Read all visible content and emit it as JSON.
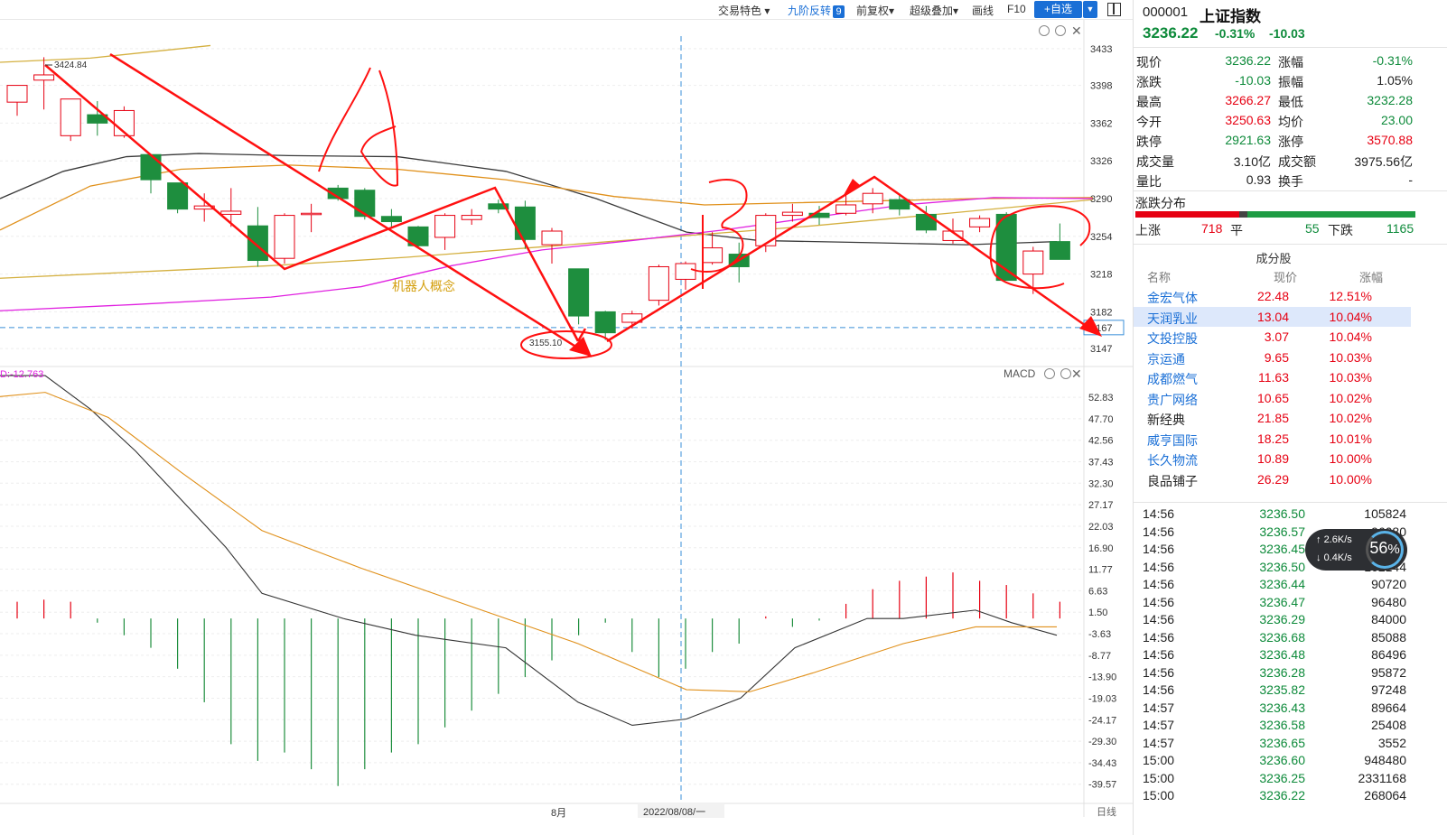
{
  "toolbar": {
    "items": [
      "交易特色",
      "九阶反转",
      "前复权",
      "超级叠加",
      "画线",
      "F10"
    ],
    "badge": "9",
    "add_button": "+自选"
  },
  "chart_data": [
    {
      "type": "candlestick",
      "title": "",
      "ylim": [
        3135,
        3445
      ],
      "y_ticks": [
        3433,
        3398,
        3362,
        3326,
        3290,
        3254,
        3218,
        3182,
        3147
      ],
      "candles": [
        {
          "o": 3382,
          "c": 3398,
          "h": 3398,
          "l": 3369
        },
        {
          "o": 3403,
          "c": 3408,
          "h": 3424.84,
          "l": 3375
        },
        {
          "o": 3350,
          "c": 3385,
          "h": 3385,
          "l": 3345
        },
        {
          "o": 3370,
          "c": 3362,
          "h": 3383,
          "l": 3350
        },
        {
          "o": 3350,
          "c": 3374,
          "h": 3378,
          "l": 3348
        },
        {
          "o": 3332,
          "c": 3308,
          "h": 3332,
          "l": 3295
        },
        {
          "o": 3305,
          "c": 3280,
          "h": 3305,
          "l": 3276
        },
        {
          "o": 3280,
          "c": 3283,
          "h": 3295,
          "l": 3268
        },
        {
          "o": 3275,
          "c": 3278,
          "h": 3300,
          "l": 3263
        },
        {
          "o": 3264,
          "c": 3231,
          "h": 3282,
          "l": 3225
        },
        {
          "o": 3233,
          "c": 3274,
          "h": 3276,
          "l": 3228
        },
        {
          "o": 3276,
          "c": 3276,
          "h": 3285,
          "l": 3258
        },
        {
          "o": 3300,
          "c": 3290,
          "h": 3303,
          "l": 3288
        },
        {
          "o": 3298,
          "c": 3273,
          "h": 3300,
          "l": 3270
        },
        {
          "o": 3273,
          "c": 3268,
          "h": 3280,
          "l": 3262
        },
        {
          "o": 3263,
          "c": 3245,
          "h": 3264,
          "l": 3243
        },
        {
          "o": 3253,
          "c": 3274,
          "h": 3276,
          "l": 3241
        },
        {
          "o": 3270,
          "c": 3274,
          "h": 3280,
          "l": 3265
        },
        {
          "o": 3285,
          "c": 3280,
          "h": 3289,
          "l": 3276
        },
        {
          "o": 3282,
          "c": 3251,
          "h": 3288,
          "l": 3242
        },
        {
          "o": 3246,
          "c": 3259,
          "h": 3262,
          "l": 3228
        },
        {
          "o": 3223,
          "c": 3178,
          "h": 3223,
          "l": 3170
        },
        {
          "o": 3182,
          "c": 3162,
          "h": 3183,
          "l": 3155.1
        },
        {
          "o": 3172,
          "c": 3180,
          "h": 3183,
          "l": 3166
        },
        {
          "o": 3193,
          "c": 3225,
          "h": 3227,
          "l": 3188
        },
        {
          "o": 3213,
          "c": 3228,
          "h": 3230,
          "l": 3203
        },
        {
          "o": 3229,
          "c": 3243,
          "h": 3258,
          "l": 3227
        },
        {
          "o": 3237,
          "c": 3225,
          "h": 3248,
          "l": 3210
        },
        {
          "o": 3245,
          "c": 3274,
          "h": 3276,
          "l": 3239
        },
        {
          "o": 3274,
          "c": 3277,
          "h": 3285,
          "l": 3268
        },
        {
          "o": 3276,
          "c": 3272,
          "h": 3283,
          "l": 3265
        },
        {
          "o": 3276,
          "c": 3284,
          "h": 3296,
          "l": 3274
        },
        {
          "o": 3285,
          "c": 3295,
          "h": 3300,
          "l": 3276
        },
        {
          "o": 3289,
          "c": 3280,
          "h": 3293,
          "l": 3274
        },
        {
          "o": 3275,
          "c": 3260,
          "h": 3283,
          "l": 3257
        },
        {
          "o": 3250,
          "c": 3259,
          "h": 3271,
          "l": 3247
        },
        {
          "o": 3263,
          "c": 3271,
          "h": 3274,
          "l": 3258
        },
        {
          "o": 3275,
          "c": 3212,
          "h": 3277,
          "l": 3212
        },
        {
          "o": 3218,
          "c": 3240,
          "h": 3244,
          "l": 3199
        },
        {
          "o": 3249,
          "c": 3232,
          "h": 3266.27,
          "l": 3232.28
        }
      ],
      "ma_lines": [
        {
          "color": "#3a3a3a",
          "points": [
            [
              0,
              3290
            ],
            [
              70,
              3316
            ],
            [
              140,
              3330
            ],
            [
              220,
              3333
            ],
            [
              320,
              3331
            ],
            [
              440,
              3330
            ],
            [
              560,
              3316
            ],
            [
              660,
              3290
            ],
            [
              760,
              3258
            ],
            [
              840,
              3250
            ],
            [
              960,
              3248
            ],
            [
              1070,
              3246
            ],
            [
              1170,
              3249
            ]
          ]
        },
        {
          "color": "#e0901a",
          "points": [
            [
              0,
              3260
            ],
            [
              100,
              3302
            ],
            [
              200,
              3318
            ],
            [
              320,
              3322
            ],
            [
              440,
              3318
            ],
            [
              560,
              3308
            ],
            [
              680,
              3292
            ],
            [
              780,
              3284
            ],
            [
              880,
              3286
            ],
            [
              980,
              3288
            ],
            [
              1080,
              3290
            ],
            [
              1210,
              3291
            ]
          ]
        },
        {
          "color": "#d4b040",
          "points": [
            [
              0,
              3214
            ],
            [
              150,
              3220
            ],
            [
              300,
              3226
            ],
            [
              450,
              3234
            ],
            [
              600,
              3244
            ],
            [
              750,
              3254
            ],
            [
              900,
              3264
            ],
            [
              1050,
              3276
            ],
            [
              1210,
              3289
            ]
          ]
        },
        {
          "color": "#e020e0",
          "points": [
            [
              0,
              3183
            ],
            [
              150,
              3189
            ],
            [
              300,
              3196
            ],
            [
              400,
              3206
            ],
            [
              500,
              3226
            ],
            [
              600,
              3241
            ],
            [
              700,
              3250
            ],
            [
              800,
              3260
            ],
            [
              900,
              3272
            ],
            [
              1000,
              3284
            ],
            [
              1100,
              3291
            ],
            [
              1210,
              3290
            ]
          ]
        },
        {
          "color": "#d4b040",
          "points": [
            [
              0,
              3420
            ],
            [
              100,
              3424
            ],
            [
              233,
              3436
            ]
          ]
        }
      ],
      "labels": {
        "high": "3424.84",
        "low": "3155.10",
        "price_line": "3167",
        "concept": "机器人概念"
      }
    },
    {
      "type": "bar",
      "title": "MACD",
      "legend_value": "D:-12.763",
      "ylim": [
        -42,
        55
      ],
      "y_ticks": [
        52.83,
        47.7,
        42.56,
        37.43,
        32.3,
        27.17,
        22.03,
        16.9,
        11.77,
        6.63,
        1.5,
        -3.63,
        -8.77,
        -13.9,
        -19.03,
        -24.17,
        -29.3,
        -34.43,
        -39.57
      ],
      "histogram": [
        4,
        4.5,
        4,
        -1,
        -4,
        -7,
        -12,
        -20,
        -30,
        -34,
        -32,
        -36,
        -40,
        -36,
        -32,
        -30,
        -26,
        -22,
        -18,
        -14,
        -10,
        -4,
        -1,
        -8,
        -14,
        -12,
        -8,
        -6,
        0.5,
        -2,
        -0.5,
        3.5,
        7,
        9,
        10,
        11,
        9,
        8,
        6,
        4
      ],
      "dif": [
        [
          0,
          58
        ],
        [
          50,
          58
        ],
        [
          100,
          50
        ],
        [
          150,
          40
        ],
        [
          250,
          17
        ],
        [
          290,
          6
        ],
        [
          380,
          0
        ],
        [
          460,
          -4
        ],
        [
          560,
          -7
        ],
        [
          640,
          -20
        ],
        [
          700,
          -25.5
        ],
        [
          760,
          -24
        ],
        [
          820,
          -19
        ],
        [
          880,
          -7
        ],
        [
          960,
          0
        ],
        [
          1000,
          0
        ],
        [
          1080,
          2
        ],
        [
          1120,
          -1
        ],
        [
          1170,
          -4
        ]
      ],
      "dea": [
        [
          0,
          53
        ],
        [
          50,
          54
        ],
        [
          120,
          48
        ],
        [
          200,
          35
        ],
        [
          290,
          21
        ],
        [
          400,
          12
        ],
        [
          520,
          3
        ],
        [
          640,
          -6
        ],
        [
          760,
          -17
        ],
        [
          830,
          -17.5
        ],
        [
          900,
          -13
        ],
        [
          1000,
          -6
        ],
        [
          1080,
          -2
        ],
        [
          1170,
          -2
        ]
      ]
    }
  ],
  "xaxis": {
    "month": "8月",
    "cursor_date": "2022/08/08/一",
    "period": "日线"
  },
  "macd_label": "MACD",
  "panel": {
    "code": "000001",
    "name": "上证指数",
    "price": "3236.22",
    "pct": "-0.31%",
    "chg": "-10.03",
    "stats": [
      [
        {
          "l": "现价",
          "v": "3236.22",
          "c": "green"
        },
        {
          "l": "涨幅",
          "v": "-0.31%",
          "c": "green"
        }
      ],
      [
        {
          "l": "涨跌",
          "v": "-10.03",
          "c": "green"
        },
        {
          "l": "振幅",
          "v": "1.05%",
          "c": "dark"
        }
      ],
      [
        {
          "l": "最高",
          "v": "3266.27",
          "c": "red"
        },
        {
          "l": "最低",
          "v": "3232.28",
          "c": "green"
        }
      ],
      [
        {
          "l": "今开",
          "v": "3250.63",
          "c": "red"
        },
        {
          "l": "均价",
          "v": "23.00",
          "c": "green"
        }
      ],
      [
        {
          "l": "跌停",
          "v": "2921.63",
          "c": "green"
        },
        {
          "l": "涨停",
          "v": "3570.88",
          "c": "red"
        }
      ],
      [
        {
          "l": "成交量",
          "v": "3.10亿",
          "c": "dark"
        },
        {
          "l": "成交额",
          "v": "3975.56亿",
          "c": "dark"
        }
      ],
      [
        {
          "l": "量比",
          "v": "0.93",
          "c": "dark"
        },
        {
          "l": "换手",
          "v": "-",
          "c": "dark"
        }
      ]
    ],
    "dist": {
      "title": "涨跌分布",
      "up_label": "上涨",
      "up": 718,
      "flat_label": "平",
      "flat": 55,
      "down_label": "下跌",
      "down": 1165
    },
    "constituents_title": "成分股",
    "constituent_headers": [
      "名称",
      "现价",
      "涨幅"
    ],
    "constituents": [
      {
        "name": "金宏气体",
        "price": "22.48",
        "pct": "12.51%",
        "nc": "blue"
      },
      {
        "name": "天润乳业",
        "price": "13.04",
        "pct": "10.04%",
        "nc": "blue"
      },
      {
        "name": "文投控股",
        "price": "3.07",
        "pct": "10.04%",
        "nc": "blue"
      },
      {
        "name": "京运通",
        "price": "9.65",
        "pct": "10.03%",
        "nc": "blue"
      },
      {
        "name": "成都燃气",
        "price": "11.63",
        "pct": "10.03%",
        "nc": "blue"
      },
      {
        "name": "贵广网络",
        "price": "10.65",
        "pct": "10.02%",
        "nc": "blue"
      },
      {
        "name": "新经典",
        "price": "21.85",
        "pct": "10.02%",
        "nc": "dark"
      },
      {
        "name": "威亨国际",
        "price": "18.25",
        "pct": "10.01%",
        "nc": "blue"
      },
      {
        "name": "长久物流",
        "price": "10.89",
        "pct": "10.00%",
        "nc": "blue"
      },
      {
        "name": "良品铺子",
        "price": "26.29",
        "pct": "10.00%",
        "nc": "dark"
      }
    ],
    "ticks": [
      {
        "t": "14:56",
        "p": "3236.50",
        "v": "105824"
      },
      {
        "t": "14:56",
        "p": "3236.57",
        "v": "96080"
      },
      {
        "t": "14:56",
        "p": "3236.45",
        "v": "96400"
      },
      {
        "t": "14:56",
        "p": "3236.50",
        "v": "102144"
      },
      {
        "t": "14:56",
        "p": "3236.44",
        "v": "90720"
      },
      {
        "t": "14:56",
        "p": "3236.47",
        "v": "96480"
      },
      {
        "t": "14:56",
        "p": "3236.29",
        "v": "84000"
      },
      {
        "t": "14:56",
        "p": "3236.68",
        "v": "85088"
      },
      {
        "t": "14:56",
        "p": "3236.48",
        "v": "86496"
      },
      {
        "t": "14:56",
        "p": "3236.28",
        "v": "95872"
      },
      {
        "t": "14:56",
        "p": "3235.82",
        "v": "97248"
      },
      {
        "t": "14:57",
        "p": "3236.43",
        "v": "89664"
      },
      {
        "t": "14:57",
        "p": "3236.58",
        "v": "25408"
      },
      {
        "t": "14:57",
        "p": "3236.65",
        "v": "3552"
      },
      {
        "t": "15:00",
        "p": "3236.60",
        "v": "948480"
      },
      {
        "t": "15:00",
        "p": "3236.25",
        "v": "2331168"
      },
      {
        "t": "15:00",
        "p": "3236.22",
        "v": "268064"
      }
    ]
  },
  "speed": {
    "up": "2.6K/s",
    "down": "0.4K/s",
    "percent": "56"
  }
}
